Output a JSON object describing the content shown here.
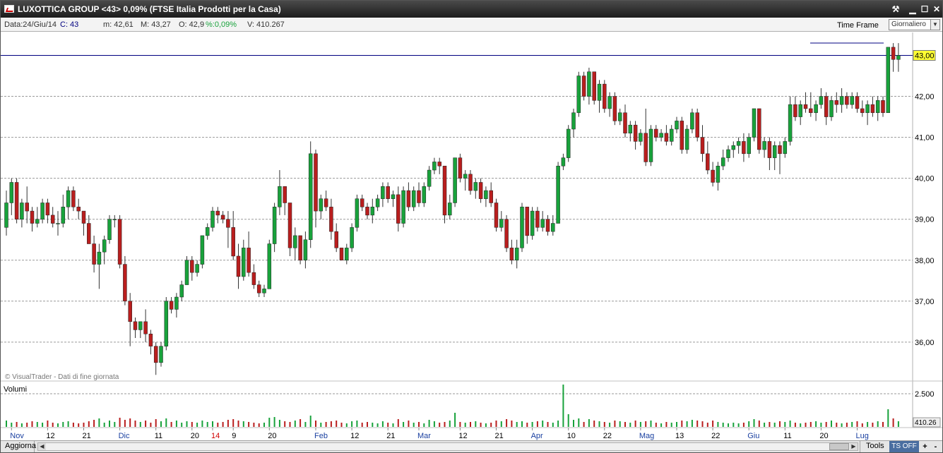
{
  "window": {
    "title": "LUXOTTICA GROUP <43> 0,09%  (FTSE Italia Prodotti per la Casa)"
  },
  "infobar": {
    "data": "Data:24/Giu/14",
    "close": "C: 43",
    "min": "m: 42,61",
    "max": "M: 43,27",
    "open": "O: 42,9",
    "pct": "%:0,09%",
    "vol": "V: 410.267",
    "timeframe_label": "Time Frame",
    "timeframe_value": "Giornaliero"
  },
  "statusbar": {
    "refresh": "Aggiorna",
    "tools": "Tools",
    "ts": "TS OFF",
    "plus": "+",
    "minus": "-"
  },
  "colors": {
    "up": "#18a23b",
    "down": "#b91e1e",
    "grid": "#9a9a9a",
    "last_price_bg": "#ffff33",
    "hline": "#000080"
  },
  "icons": [
    "chart-icon",
    "pin-icon",
    "minimize-icon",
    "maximize-icon",
    "close-icon"
  ],
  "chart_data": {
    "type": "candlestick",
    "y_ticks": [
      "43,00",
      "42,00",
      "41,00",
      "40,00",
      "39,00",
      "38,00",
      "37,00",
      "36,00"
    ],
    "y_range": [
      35.05,
      43.56
    ],
    "last_price_label": "43,00",
    "horizontal_line": 43.0,
    "watermark": "© VisualTrader - Dati di fine giornata",
    "volume_label": "Volumi",
    "volume_tick": "2.500",
    "volume_last": "410.26",
    "x_labels": [
      {
        "label": "Nov",
        "i": 1,
        "month": true
      },
      {
        "label": "12",
        "i": 8
      },
      {
        "label": "21",
        "i": 15
      },
      {
        "label": "Dic",
        "i": 22,
        "month": true
      },
      {
        "label": "11",
        "i": 29
      },
      {
        "label": "20",
        "i": 36
      },
      {
        "label": "14",
        "i": 40,
        "red": true
      },
      {
        "label": "9",
        "i": 44
      },
      {
        "label": "20",
        "i": 51
      },
      {
        "label": "Feb",
        "i": 60,
        "month": true
      },
      {
        "label": "12",
        "i": 67
      },
      {
        "label": "21",
        "i": 74
      },
      {
        "label": "Mar",
        "i": 80,
        "month": true
      },
      {
        "label": "12",
        "i": 88
      },
      {
        "label": "21",
        "i": 95
      },
      {
        "label": "Apr",
        "i": 102,
        "month": true
      },
      {
        "label": "10",
        "i": 109
      },
      {
        "label": "22",
        "i": 116
      },
      {
        "label": "Mag",
        "i": 123,
        "month": true
      },
      {
        "label": "13",
        "i": 130
      },
      {
        "label": "22",
        "i": 137
      },
      {
        "label": "Giu",
        "i": 144,
        "month": true
      },
      {
        "label": "11",
        "i": 151
      },
      {
        "label": "20",
        "i": 158
      },
      {
        "label": "Lug",
        "i": 165,
        "month": true
      }
    ],
    "candles": [
      [
        38.8,
        39.7,
        38.6,
        39.4,
        90
      ],
      [
        39.4,
        40.0,
        39.1,
        39.9,
        60
      ],
      [
        39.9,
        40.0,
        38.9,
        39.0,
        70
      ],
      [
        39.0,
        39.5,
        38.8,
        39.4,
        50
      ],
      [
        39.4,
        39.8,
        38.9,
        39.2,
        60
      ],
      [
        39.2,
        39.3,
        38.7,
        38.9,
        80
      ],
      [
        38.9,
        39.3,
        38.8,
        39.0,
        70
      ],
      [
        39.0,
        39.5,
        38.9,
        39.4,
        60
      ],
      [
        39.4,
        39.5,
        38.9,
        39.1,
        90
      ],
      [
        39.1,
        39.3,
        38.8,
        38.9,
        60
      ],
      [
        38.9,
        39.2,
        38.6,
        38.9,
        50
      ],
      [
        38.9,
        39.6,
        38.8,
        39.3,
        70
      ],
      [
        39.3,
        39.8,
        39.0,
        39.7,
        80
      ],
      [
        39.7,
        39.8,
        39.2,
        39.3,
        60
      ],
      [
        39.3,
        39.5,
        39.0,
        39.2,
        50
      ],
      [
        39.2,
        39.2,
        38.6,
        38.9,
        60
      ],
      [
        38.9,
        39.1,
        38.4,
        38.4,
        80
      ],
      [
        38.4,
        38.6,
        37.7,
        37.9,
        100
      ],
      [
        37.9,
        38.4,
        37.3,
        38.2,
        120
      ],
      [
        38.2,
        38.6,
        37.9,
        38.5,
        60
      ],
      [
        38.5,
        39.1,
        38.4,
        39.0,
        90
      ],
      [
        39.0,
        39.1,
        38.8,
        39.0,
        70
      ],
      [
        39.0,
        39.1,
        37.8,
        37.9,
        130
      ],
      [
        37.9,
        38.1,
        36.9,
        37.0,
        100
      ],
      [
        37.0,
        37.2,
        35.9,
        36.5,
        120
      ],
      [
        36.5,
        36.6,
        36.1,
        36.3,
        90
      ],
      [
        36.3,
        36.5,
        36.1,
        36.5,
        70
      ],
      [
        36.5,
        36.8,
        36.0,
        36.2,
        90
      ],
      [
        36.2,
        36.3,
        35.7,
        35.9,
        60
      ],
      [
        35.9,
        36.0,
        35.2,
        35.5,
        110
      ],
      [
        35.5,
        36.0,
        35.4,
        35.9,
        80
      ],
      [
        35.9,
        37.1,
        35.8,
        37.0,
        120
      ],
      [
        37.0,
        37.1,
        36.7,
        36.8,
        70
      ],
      [
        36.8,
        37.2,
        36.6,
        37.1,
        90
      ],
      [
        37.1,
        37.5,
        37.0,
        37.4,
        60
      ],
      [
        37.4,
        38.1,
        37.4,
        38.0,
        80
      ],
      [
        38.0,
        38.1,
        37.5,
        37.7,
        70
      ],
      [
        37.7,
        38.0,
        37.6,
        37.9,
        60
      ],
      [
        37.9,
        38.6,
        37.8,
        38.6,
        90
      ],
      [
        38.6,
        38.9,
        38.5,
        38.8,
        70
      ],
      [
        38.8,
        39.3,
        38.7,
        39.2,
        80
      ],
      [
        39.2,
        39.3,
        38.9,
        39.1,
        60
      ],
      [
        39.1,
        39.2,
        38.9,
        39.0,
        70
      ],
      [
        39.0,
        39.2,
        38.3,
        38.8,
        100
      ],
      [
        38.8,
        39.2,
        38.0,
        38.1,
        110
      ],
      [
        38.1,
        38.4,
        37.3,
        37.6,
        90
      ],
      [
        37.6,
        38.5,
        37.5,
        38.3,
        80
      ],
      [
        38.3,
        38.7,
        37.6,
        37.7,
        70
      ],
      [
        37.7,
        37.9,
        37.3,
        37.4,
        60
      ],
      [
        37.4,
        37.5,
        37.1,
        37.2,
        50
      ],
      [
        37.2,
        37.4,
        37.1,
        37.3,
        60
      ],
      [
        37.3,
        38.5,
        37.7,
        38.4,
        130
      ],
      [
        38.4,
        39.4,
        38.2,
        39.3,
        140
      ],
      [
        39.3,
        40.2,
        39.1,
        39.8,
        100
      ],
      [
        39.8,
        39.8,
        39.1,
        39.4,
        80
      ],
      [
        39.4,
        39.4,
        38.1,
        38.3,
        70
      ],
      [
        38.3,
        38.8,
        38.0,
        38.6,
        90
      ],
      [
        38.6,
        38.6,
        37.9,
        38.0,
        110
      ],
      [
        38.0,
        38.7,
        37.8,
        38.5,
        70
      ],
      [
        38.5,
        40.9,
        38.3,
        40.6,
        160
      ],
      [
        40.6,
        40.7,
        38.8,
        39.2,
        90
      ],
      [
        39.2,
        39.6,
        39.0,
        39.5,
        60
      ],
      [
        39.5,
        39.7,
        39.2,
        39.3,
        70
      ],
      [
        39.3,
        39.5,
        38.5,
        38.7,
        80
      ],
      [
        38.7,
        38.9,
        38.2,
        38.3,
        90
      ],
      [
        38.3,
        38.3,
        38.0,
        38.0,
        60
      ],
      [
        38.0,
        38.4,
        37.9,
        38.3,
        50
      ],
      [
        38.3,
        38.9,
        38.2,
        38.8,
        80
      ],
      [
        38.8,
        39.6,
        38.7,
        39.5,
        90
      ],
      [
        39.5,
        39.6,
        39.2,
        39.3,
        60
      ],
      [
        39.3,
        39.4,
        39.0,
        39.1,
        70
      ],
      [
        39.1,
        39.5,
        38.9,
        39.3,
        60
      ],
      [
        39.3,
        39.6,
        39.2,
        39.5,
        50
      ],
      [
        39.5,
        39.9,
        39.3,
        39.8,
        80
      ],
      [
        39.8,
        39.9,
        39.4,
        39.5,
        60
      ],
      [
        39.5,
        39.7,
        39.3,
        39.6,
        50
      ],
      [
        39.6,
        39.8,
        38.7,
        38.9,
        110
      ],
      [
        38.9,
        39.8,
        38.8,
        39.7,
        70
      ],
      [
        39.7,
        39.9,
        39.2,
        39.3,
        90
      ],
      [
        39.3,
        39.8,
        39.2,
        39.7,
        60
      ],
      [
        39.7,
        39.9,
        39.3,
        39.4,
        70
      ],
      [
        39.4,
        39.9,
        39.3,
        39.8,
        50
      ],
      [
        39.8,
        40.3,
        39.7,
        40.2,
        100
      ],
      [
        40.2,
        40.5,
        40.1,
        40.4,
        80
      ],
      [
        40.4,
        40.5,
        40.1,
        40.3,
        60
      ],
      [
        40.3,
        40.3,
        38.9,
        39.1,
        70
      ],
      [
        39.1,
        39.6,
        39.0,
        39.4,
        90
      ],
      [
        39.4,
        40.5,
        39.3,
        40.5,
        200
      ],
      [
        40.5,
        40.6,
        39.9,
        40.0,
        70
      ],
      [
        40.0,
        40.2,
        39.7,
        40.1,
        60
      ],
      [
        40.1,
        40.2,
        39.6,
        39.7,
        70
      ],
      [
        39.7,
        40.0,
        39.5,
        39.9,
        80
      ],
      [
        39.9,
        40.0,
        39.4,
        39.5,
        60
      ],
      [
        39.5,
        39.8,
        39.3,
        39.7,
        50
      ],
      [
        39.7,
        39.9,
        39.3,
        39.4,
        60
      ],
      [
        39.4,
        39.5,
        38.7,
        38.8,
        90
      ],
      [
        38.8,
        39.2,
        38.7,
        39.0,
        80
      ],
      [
        39.0,
        39.1,
        38.2,
        38.3,
        110
      ],
      [
        38.3,
        38.5,
        37.9,
        38.0,
        90
      ],
      [
        38.0,
        38.5,
        37.8,
        38.3,
        70
      ],
      [
        38.3,
        39.4,
        38.2,
        39.3,
        80
      ],
      [
        39.3,
        39.3,
        38.4,
        38.6,
        60
      ],
      [
        38.6,
        39.3,
        38.5,
        39.2,
        70
      ],
      [
        39.2,
        39.3,
        38.7,
        38.8,
        80
      ],
      [
        38.8,
        39.2,
        38.7,
        39.0,
        90
      ],
      [
        39.0,
        39.1,
        38.6,
        38.7,
        70
      ],
      [
        38.7,
        39.1,
        38.6,
        38.9,
        60
      ],
      [
        38.9,
        40.4,
        39.0,
        40.3,
        90
      ],
      [
        40.3,
        40.6,
        40.2,
        40.5,
        600
      ],
      [
        40.5,
        41.3,
        40.4,
        41.2,
        180
      ],
      [
        41.2,
        41.7,
        41.0,
        41.6,
        100
      ],
      [
        41.6,
        42.6,
        41.5,
        42.5,
        120
      ],
      [
        42.5,
        42.6,
        41.9,
        42.0,
        70
      ],
      [
        42.0,
        42.7,
        41.8,
        42.6,
        110
      ],
      [
        42.6,
        42.6,
        41.8,
        41.9,
        90
      ],
      [
        41.9,
        42.4,
        41.6,
        42.3,
        80
      ],
      [
        42.3,
        42.4,
        41.6,
        41.7,
        70
      ],
      [
        41.7,
        42.1,
        41.5,
        42.0,
        60
      ],
      [
        42.0,
        42.1,
        41.3,
        41.4,
        90
      ],
      [
        41.4,
        41.7,
        41.3,
        41.6,
        80
      ],
      [
        41.6,
        41.8,
        41.0,
        41.1,
        70
      ],
      [
        41.1,
        41.4,
        40.9,
        41.3,
        60
      ],
      [
        41.3,
        41.4,
        40.7,
        40.9,
        90
      ],
      [
        40.9,
        41.2,
        40.8,
        41.1,
        70
      ],
      [
        41.1,
        41.7,
        40.3,
        40.4,
        80
      ],
      [
        40.4,
        41.3,
        40.3,
        41.2,
        90
      ],
      [
        41.2,
        41.3,
        40.9,
        41.0,
        60
      ],
      [
        41.0,
        41.2,
        40.9,
        41.1,
        50
      ],
      [
        41.1,
        41.3,
        40.8,
        40.9,
        70
      ],
      [
        40.9,
        41.3,
        40.8,
        41.2,
        60
      ],
      [
        41.2,
        41.5,
        41.1,
        41.4,
        70
      ],
      [
        41.4,
        41.5,
        40.6,
        40.7,
        90
      ],
      [
        40.7,
        41.3,
        40.6,
        41.2,
        80
      ],
      [
        41.2,
        41.7,
        41.1,
        41.6,
        100
      ],
      [
        41.6,
        41.7,
        40.9,
        41.0,
        90
      ],
      [
        41.0,
        41.3,
        40.4,
        40.6,
        80
      ],
      [
        40.6,
        40.9,
        40.1,
        40.2,
        60
      ],
      [
        40.2,
        40.4,
        39.8,
        39.9,
        90
      ],
      [
        39.9,
        40.4,
        39.7,
        40.3,
        70
      ],
      [
        40.3,
        40.7,
        40.2,
        40.5,
        60
      ],
      [
        40.5,
        40.8,
        40.4,
        40.7,
        50
      ],
      [
        40.7,
        40.9,
        40.5,
        40.8,
        60
      ],
      [
        40.8,
        41.0,
        40.6,
        40.9,
        50
      ],
      [
        40.9,
        41.1,
        40.4,
        40.6,
        60
      ],
      [
        40.6,
        41.1,
        40.5,
        41.0,
        80
      ],
      [
        41.0,
        41.7,
        40.9,
        41.7,
        110
      ],
      [
        41.7,
        41.7,
        40.6,
        40.7,
        90
      ],
      [
        40.7,
        41.0,
        40.5,
        40.9,
        60
      ],
      [
        40.9,
        41.0,
        40.2,
        40.5,
        70
      ],
      [
        40.5,
        40.9,
        40.2,
        40.8,
        60
      ],
      [
        40.8,
        40.9,
        40.1,
        40.6,
        80
      ],
      [
        40.6,
        41.0,
        40.5,
        40.9,
        70
      ],
      [
        40.9,
        42.0,
        40.8,
        41.8,
        90
      ],
      [
        41.8,
        42.0,
        41.4,
        41.5,
        60
      ],
      [
        41.5,
        41.9,
        41.3,
        41.8,
        50
      ],
      [
        41.8,
        42.1,
        41.6,
        41.7,
        60
      ],
      [
        41.7,
        42.1,
        41.5,
        41.6,
        70
      ],
      [
        41.6,
        41.9,
        41.4,
        41.8,
        80
      ],
      [
        41.8,
        42.2,
        41.7,
        42.0,
        60
      ],
      [
        42.0,
        42.1,
        41.3,
        41.5,
        70
      ],
      [
        41.5,
        42.0,
        41.4,
        41.9,
        90
      ],
      [
        41.9,
        42.1,
        41.6,
        41.8,
        60
      ],
      [
        41.8,
        42.2,
        41.6,
        42.0,
        50
      ],
      [
        42.0,
        42.1,
        41.7,
        41.8,
        60
      ],
      [
        41.8,
        42.1,
        41.7,
        42.0,
        70
      ],
      [
        42.0,
        42.1,
        41.6,
        41.7,
        80
      ],
      [
        41.7,
        41.9,
        41.5,
        41.6,
        50
      ],
      [
        41.6,
        41.9,
        41.3,
        41.8,
        70
      ],
      [
        41.8,
        42.0,
        41.5,
        41.6,
        60
      ],
      [
        41.6,
        42.0,
        41.4,
        41.9,
        80
      ],
      [
        41.9,
        42.0,
        41.5,
        41.6,
        70
      ],
      [
        41.6,
        43.2,
        42.0,
        43.2,
        250
      ],
      [
        43.2,
        43.3,
        42.6,
        42.9,
        120
      ],
      [
        42.9,
        43.3,
        42.6,
        43.0,
        80
      ]
    ]
  }
}
